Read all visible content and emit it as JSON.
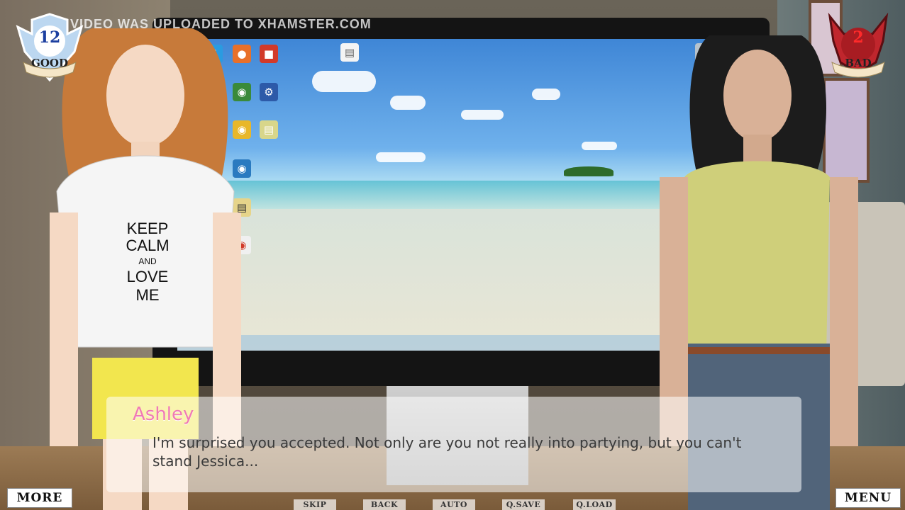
{
  "watermark": "THIS VIDEO WAS UPLOADED TO XHAMSTER.COM",
  "good_badge": {
    "value": "12",
    "label": "GOOD"
  },
  "bad_badge": {
    "value": "2",
    "label": "BAD"
  },
  "dialogue": {
    "speaker": "Ashley",
    "text": "I'm surprised you accepted. Not only are you not really into partying, but you can't stand Jessica..."
  },
  "tshirt_text": [
    "KEEP",
    "CALM",
    "AND",
    "LOVE",
    "ME"
  ],
  "buttons": {
    "more": "MORE",
    "menu": "MENU",
    "skip": "SKIP",
    "back": "BACK",
    "auto": "AUTO",
    "qsave": "Q.SAVE",
    "qload": "Q.LOAD"
  },
  "colors": {
    "speaker": "#f07ab4",
    "good_badge": "#bcd7f0",
    "bad_badge": "#c0262d"
  },
  "icons": [
    "computer-icon",
    "skype-icon",
    "firefox-icon",
    "file-icon",
    "recycle-bin-icon",
    "network-icon",
    "chrome-icon",
    "folder-icon"
  ]
}
